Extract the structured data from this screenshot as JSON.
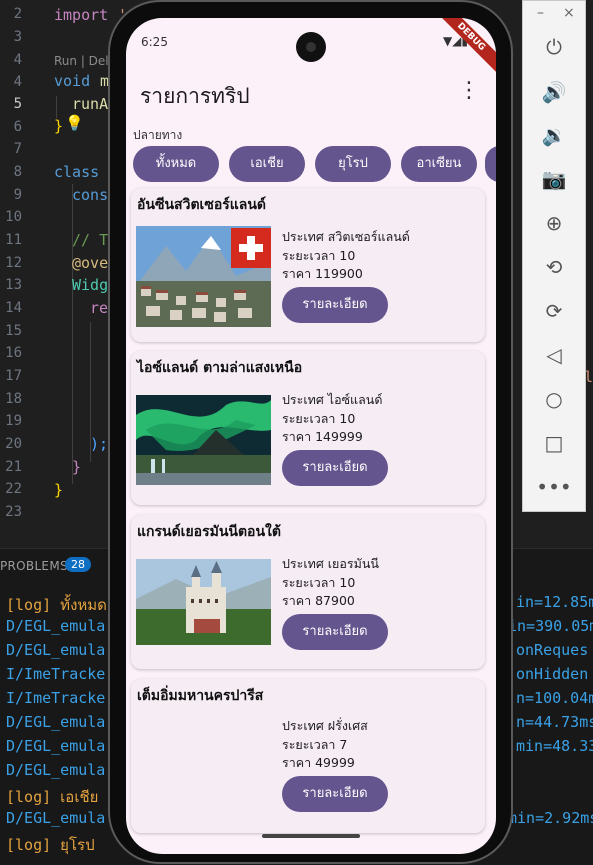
{
  "editor": {
    "line_numbers": [
      "2",
      "3",
      "4",
      "5",
      "6",
      "7",
      "8",
      "9",
      "10",
      "11",
      "12",
      "13",
      "14",
      "15",
      "16",
      "17",
      "18",
      "19",
      "20",
      "21",
      "22",
      "23"
    ],
    "active_line": "5",
    "run_hint": "Run | Del",
    "lines": {
      "l2_kw": "import",
      "l2_str": "'r",
      "l4_kw": "void",
      "l4_fn": "m",
      "l5_fn": "runA",
      "l6_tx": "}",
      "l8_kw": "class",
      "l9_kw": "cons",
      "l11_cm": "// T",
      "l12_ann": "@ove",
      "l13_cl": "Widg",
      "l14_kw": "re",
      "l20_tx": ");",
      "l21_tx": "}",
      "l22_tx": "}"
    },
    "right_fragment": "lo"
  },
  "problems_panel": {
    "label": "PROBLEMS",
    "count": "28",
    "logs_left": [
      {
        "text": "[log] ทั้งหมด",
        "color": "orange"
      },
      {
        "text": "D/EGL_emula",
        "color": "blue"
      },
      {
        "text": "D/EGL_emula",
        "color": "blue"
      },
      {
        "text": "I/ImeTracke",
        "color": "blue"
      },
      {
        "text": "I/ImeTracke",
        "color": "blue"
      },
      {
        "text": "D/EGL_emula",
        "color": "blue"
      },
      {
        "text": "D/EGL_emula",
        "color": "blue"
      },
      {
        "text": "D/EGL_emula",
        "color": "blue"
      },
      {
        "text": "[log] เอเชีย",
        "color": "orange"
      },
      {
        "text": "D/EGL_emula",
        "color": "blue"
      },
      {
        "text": "[log] ยุโรป",
        "color": "orange"
      }
    ],
    "logs_right": [
      "in=12.85m",
      "in=390.05m",
      "onReques",
      "onHidden",
      "n=100.04m",
      "n=44.73ms",
      "min=48.33",
      "",
      "",
      "min=2.92ms",
      ""
    ]
  },
  "emulator_toolbar": {
    "minimize": "–",
    "close": "×",
    "buttons": [
      "power-icon",
      "volume-up-icon",
      "volume-down-icon",
      "camera-icon",
      "zoom-in-icon",
      "rotate-left-icon",
      "rotate-right-icon",
      "back-icon",
      "home-icon",
      "overview-icon",
      "more-icon"
    ]
  },
  "status_bar": {
    "time": "6:25",
    "debug_label": "DEBUG"
  },
  "app": {
    "title": "รายการทริป",
    "section_label": "ปลายทาง",
    "chips": [
      "ทั้งหมด",
      "เอเชีย",
      "ยุโรป",
      "อาเซียน"
    ],
    "accent_color": "#65558f",
    "trips": [
      {
        "title": "อันซีนสวิตเซอร์แลนด์",
        "country": "ประเทศ สวิตเซอร์แลนด์",
        "duration": "ระยะเวลา 10",
        "price": "ราคา 119900",
        "button": "รายละเอียด",
        "image": "switzerland"
      },
      {
        "title": "ไอซ์แลนด์ ตามล่าแสงเหนือ",
        "country": "ประเทศ ไอซ์แลนด์",
        "duration": "ระยะเวลา 10",
        "price": "ราคา 149999",
        "button": "รายละเอียด",
        "image": "iceland"
      },
      {
        "title": "แกรนด์เยอรมันนีตอนใต้",
        "country": "ประเทศ เยอรมันนี",
        "duration": "ระยะเวลา 10",
        "price": "ราคา 87900",
        "button": "รายละเอียด",
        "image": "germany"
      },
      {
        "title": "เต็มอิ่มมหานครปารีส",
        "country": "ประเทศ ฝรั่งเศส",
        "duration": "ระยะเวลา 7",
        "price": "ราคา 49999",
        "button": "รายละเอียด",
        "image": ""
      }
    ]
  }
}
